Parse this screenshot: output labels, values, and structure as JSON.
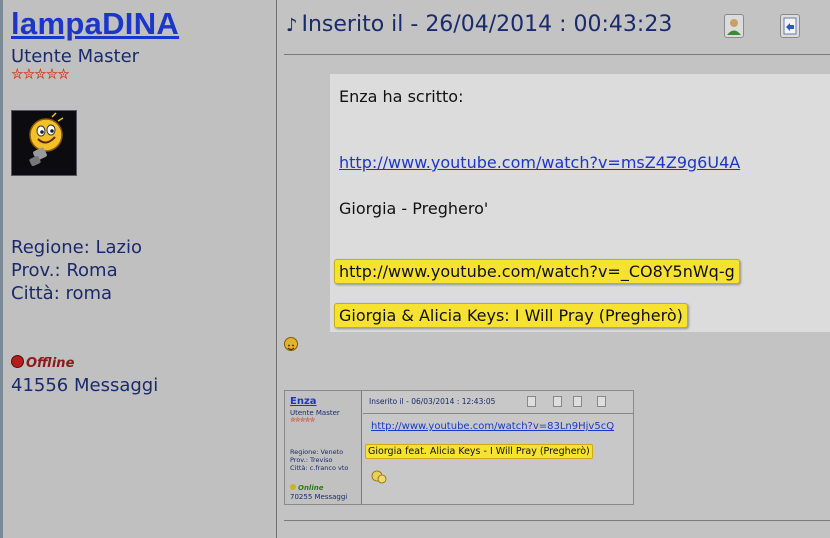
{
  "user": {
    "name": "lampaDINA",
    "rank": "Utente Master",
    "stars": "✮✮✮✮✮",
    "region": "Regione: Lazio",
    "province": "Prov.: Roma",
    "city": "Città: roma",
    "status": "Offline",
    "posts": "41556 Messaggi"
  },
  "post": {
    "header": "Inserito il - 26/04/2014 : 00:43:23",
    "quote_author": "Enza ha scritto:",
    "quote_link1": "http://www.youtube.com/watch?v=msZ4Z9g6U4A",
    "quote_line1": "Giorgia - Preghero'",
    "quote_link2": "http://www.youtube.com/watch?v=_CO8Y5nWq-g",
    "quote_line2": "Giorgia & Alicia Keys: I Will Pray (Pregherò)"
  },
  "embedded": {
    "user_name": "Enza",
    "user_rank": "Utente Master",
    "user_stars": "✮✮✮✮✮",
    "region": "Regione: Veneto",
    "province": "Prov.: Treviso",
    "city": "Città: c.franco vto",
    "status": "Online",
    "posts": "70255 Messaggi",
    "header": "Inserito il - 06/03/2014 : 12:43:05",
    "link": "http://www.youtube.com/watch?v=83Ln9Hjv5cQ",
    "highlight": "Giorgia feat. Alicia Keys - I Will Pray (Pregherò)"
  },
  "colors": {
    "link": "#1b36c9",
    "highlight": "#f7e232",
    "background": "#c3c3c3"
  }
}
